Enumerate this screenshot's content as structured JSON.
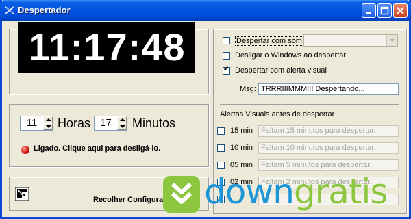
{
  "window": {
    "title": "Despertador"
  },
  "clock": {
    "time": "11:17:48"
  },
  "alarm": {
    "hours_value": "11",
    "hours_label": "Horas",
    "minutes_value": "17",
    "minutes_label": "Minutos",
    "status_text": "Ligado. Clique aqui para desligá-lo.",
    "status_color": "#d01010"
  },
  "options": {
    "wake_sound": {
      "label": "Despertar com som",
      "checked": false
    },
    "shutdown": {
      "label": "Desligar o Windows ao despertar",
      "checked": false
    },
    "visual_alert": {
      "label": "Despertar com alerta visual",
      "checked": true
    },
    "msg_label": "Msg:",
    "msg_value": "TRRRIIIMMM!!! Despertando..."
  },
  "visual_alerts": {
    "heading": "Alertas Visuais antes de despertar",
    "items": [
      {
        "label": "15 min",
        "text": "Faltam 15 minutos para despertar."
      },
      {
        "label": "10 min",
        "text": "Faltam 10 minutos para despertar."
      },
      {
        "label": "05 min",
        "text": "Faltam 5 minutos para despertar."
      },
      {
        "label": "02 min",
        "text": "Faltam 2 minutos para despertar."
      }
    ]
  },
  "footer": {
    "collapse_label": "Recolher Configurações"
  },
  "watermark": {
    "part1": "down",
    "part2": "gratis",
    "color1": "#1d95d6",
    "color2": "#8dc63f"
  }
}
